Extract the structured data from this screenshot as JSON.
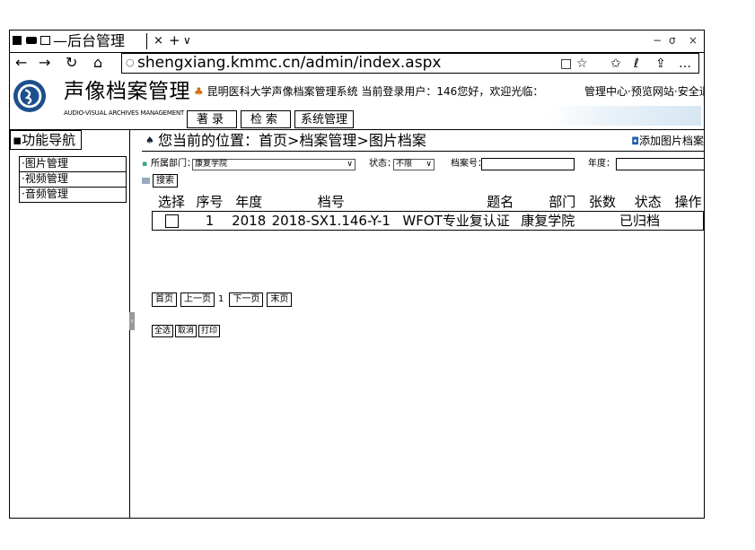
{
  "browser": {
    "tab_title": "—后台管理",
    "tab_close": "×",
    "tab_new": "+",
    "tab_dropdown": "∨",
    "win_min": "−",
    "win_max": "σ",
    "win_close": "×",
    "nav_back": "←",
    "nav_forward": "→",
    "nav_refresh": "↻",
    "nav_home": "⌂",
    "lock": "○",
    "url": "shengxiang.kmmc.cn/admin/index.aspx",
    "icons": [
      "reading-view-icon",
      "favorite-star-icon",
      "favorites-hub-icon",
      "pen-icon",
      "share-icon",
      "more-icon"
    ],
    "icon_glyphs": {
      "reading": "□",
      "star": "☆",
      "hub": "✩",
      "pen": "ℓ",
      "share": "⇪",
      "more": "…"
    }
  },
  "header": {
    "site_name": "声像档案管理",
    "site_subtitle": "AUDIO-VISUAL ARCHIVES MANAGEMENT",
    "welcome": "昆明医科大学声像档案管理系统 当前登录用户：146您好，欢迎光临：",
    "quick_links": [
      "管理中心",
      "预览网站",
      "安全退出"
    ],
    "top_nav": [
      "著录",
      "检索",
      "系统管理"
    ]
  },
  "sidebar": {
    "title": "功能导航",
    "items": [
      "图片管理",
      "视频管理",
      "音频管理"
    ]
  },
  "main": {
    "breadcrumb": "您当前的位置：首页>档案管理>图片档案",
    "add_link": "添加图片档案",
    "filter": {
      "dept_label": "所属部门：",
      "dept_value": "康复学院",
      "status_label": "状态：",
      "status_value": "不限",
      "archive_no_label": "档案号：",
      "year_label": "年度：",
      "search_button": "搜索"
    },
    "table": {
      "headers": [
        "选择",
        "序号",
        "年度",
        "档号",
        "题名",
        "部门",
        "张数",
        "状态",
        "操作"
      ],
      "rows": [
        {
          "index": "1",
          "year": "2018",
          "archive_no": "2018-SX1.146-Y-1",
          "title": "WFOT专业复认证",
          "department": "康复学院",
          "count": "",
          "status": "已归档",
          "ops": ""
        }
      ]
    },
    "pager": {
      "first": "首页",
      "prev": "上一页",
      "current": "1",
      "next": "下一页",
      "last": "末页"
    },
    "actions": {
      "select_all": "全选",
      "cancel": "取消",
      "print": "打印"
    }
  }
}
